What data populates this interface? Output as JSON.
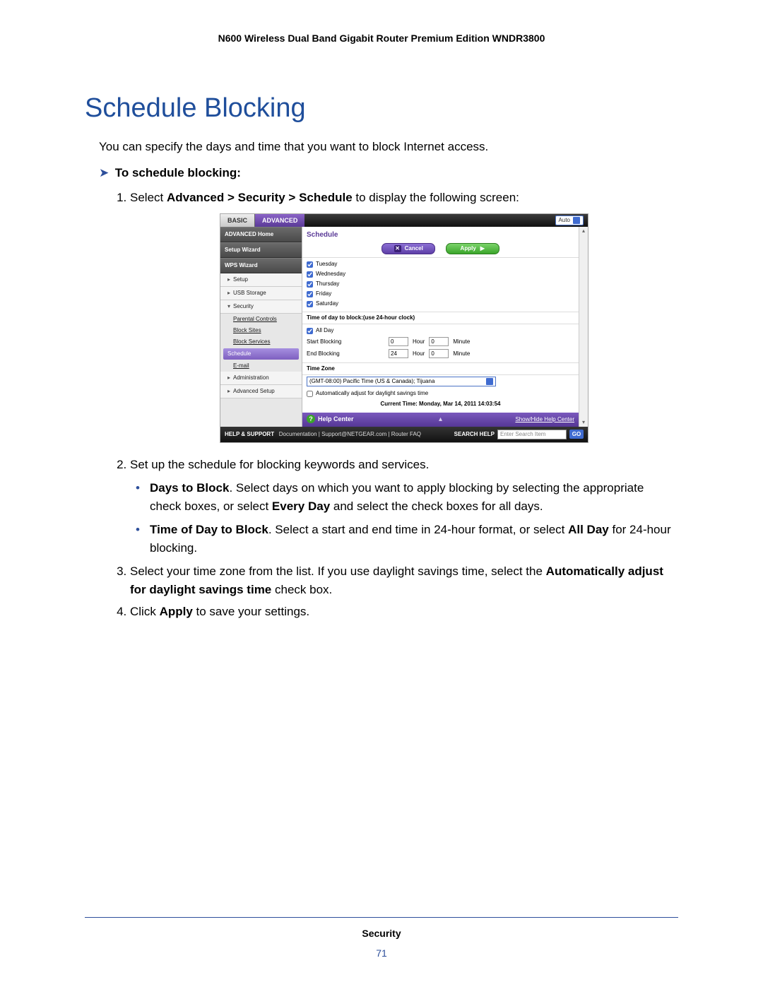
{
  "header": "N600 Wireless Dual Band Gigabit Router Premium Edition WNDR3800",
  "title": "Schedule Blocking",
  "intro": "You can specify the days and time that you want to block Internet access.",
  "task_label": "To schedule blocking:",
  "steps": {
    "s1_a": "Select ",
    "s1_b": "Advanced > Security > Schedule",
    "s1_c": " to display the following screen:",
    "s2": "Set up the schedule for blocking keywords and services.",
    "s2_b1_a": "Days to Block",
    "s2_b1_b": ". Select days on which you want to apply blocking by selecting the appropriate check boxes, or select ",
    "s2_b1_c": "Every Day",
    "s2_b1_d": " and select the check boxes for all days.",
    "s2_b2_a": "Time of Day to Block",
    "s2_b2_b": ". Select a start and end time in 24-hour format, or select ",
    "s2_b2_c": "All Day",
    "s2_b2_d": " for 24-hour blocking.",
    "s3_a": "Select your time zone from the list. If you use daylight savings time, select the ",
    "s3_b": "Automatically adjust for daylight savings time",
    "s3_c": " check box.",
    "s4_a": "Click ",
    "s4_b": "Apply",
    "s4_c": " to save your settings."
  },
  "shot": {
    "tabs": {
      "basic": "BASIC",
      "advanced": "ADVANCED"
    },
    "auto": "Auto",
    "sidebar": {
      "advanced_home": "ADVANCED Home",
      "setup_wizard": "Setup Wizard",
      "wps_wizard": "WPS Wizard",
      "setup": "Setup",
      "usb_storage": "USB Storage",
      "security": "Security",
      "sec_items": {
        "parental": "Parental Controls",
        "block_sites": "Block Sites",
        "block_services": "Block Services",
        "schedule": "Schedule",
        "email": "E-mail"
      },
      "administration": "Administration",
      "advanced_setup": "Advanced Setup"
    },
    "content": {
      "title": "Schedule",
      "cancel": "Cancel",
      "apply": "Apply",
      "days": {
        "tue": "Tuesday",
        "wed": "Wednesday",
        "thu": "Thursday",
        "fri": "Friday",
        "sat": "Saturday"
      },
      "time_title": "Time of day to block:(use 24-hour clock)",
      "all_day": "All Day",
      "start_blocking": "Start Blocking",
      "end_blocking": "End Blocking",
      "start_hour": "0",
      "start_min": "0",
      "end_hour": "24",
      "end_min": "0",
      "hour_lbl": "Hour",
      "minute_lbl": "Minute",
      "tz_title": "Time Zone",
      "tz_value": "(GMT-08:00) Pacific Time (US & Canada); Tijuana",
      "dst": "Automatically adjust for daylight savings time",
      "current_time": "Current Time: Monday, Mar 14, 2011 14:03:54",
      "help_center": "Help Center",
      "show_hide": "Show/Hide Help Center"
    },
    "footer": {
      "help_support": "HELP & SUPPORT",
      "links": "Documentation  |  Support@NETGEAR.com  |  Router FAQ",
      "search_help": "SEARCH HELP",
      "placeholder": "Enter Search Item",
      "go": "GO"
    }
  },
  "page_footer": {
    "chapter": "Security",
    "page": "71"
  }
}
